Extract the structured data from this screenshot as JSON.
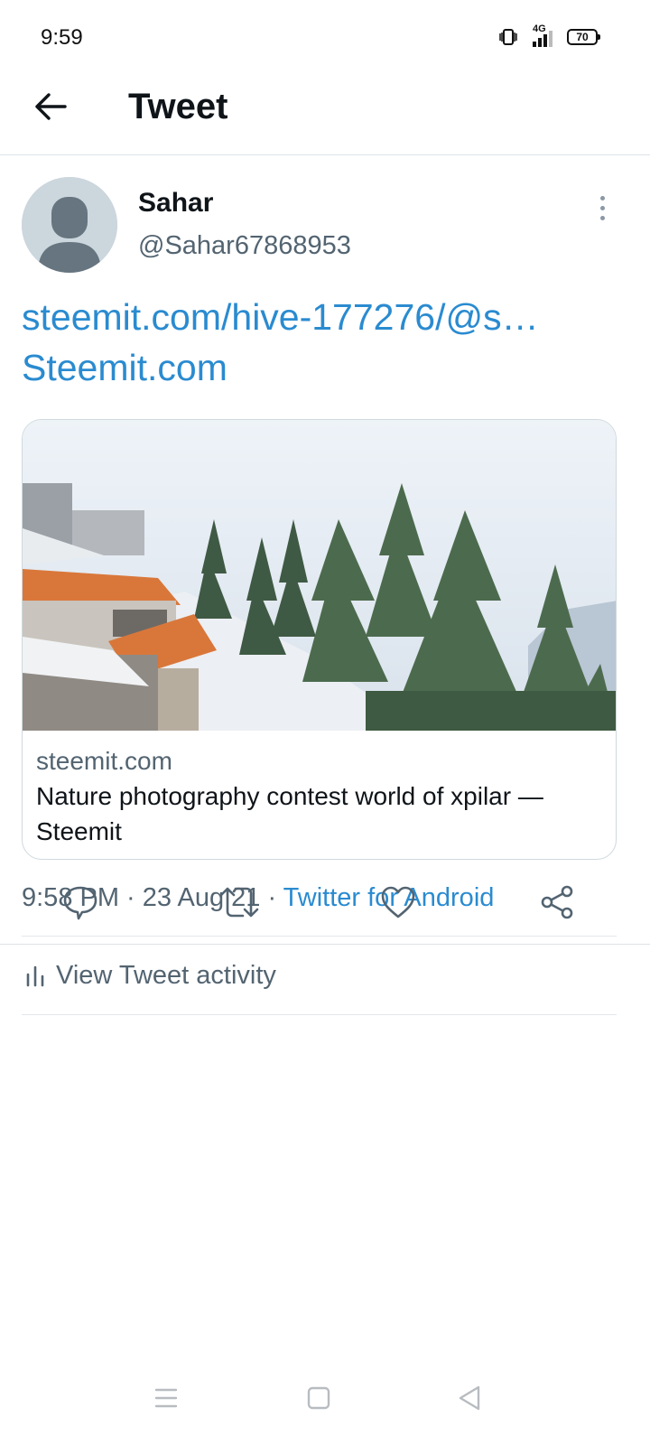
{
  "status_bar": {
    "time": "9:59",
    "network_label": "4G",
    "battery_level": "70",
    "icons": [
      "vibrate-icon",
      "signal-4g-icon",
      "battery-icon"
    ]
  },
  "header": {
    "back_icon": "arrow-left-icon",
    "title": "Tweet"
  },
  "tweet": {
    "author": {
      "display_name": "Sahar",
      "handle": "@Sahar67868953",
      "avatar_icon": "default-avatar-icon"
    },
    "more_icon": "more-vertical-icon",
    "text_line1": "steemit.com/hive-177276/@s…",
    "text_line2": "Steemit.com",
    "card": {
      "domain": "steemit.com",
      "title": "Nature photography contest world of xpilar — Steemit",
      "image_description": "snowy hillside with orange-roofed buildings and pine trees"
    },
    "meta": {
      "time": "9:58 PM",
      "separator": " · ",
      "date": "23 Aug 21",
      "source": "Twitter for Android"
    },
    "activity_label": "View Tweet activity",
    "actions": [
      {
        "name": "reply",
        "icon": "comment-icon"
      },
      {
        "name": "retweet",
        "icon": "retweet-icon"
      },
      {
        "name": "like",
        "icon": "heart-icon"
      },
      {
        "name": "share",
        "icon": "share-icon"
      }
    ]
  },
  "colors": {
    "link": "#2a8bd0",
    "text_primary": "#0f1419",
    "text_secondary": "#536471",
    "divider": "#dfe3e6"
  },
  "nav_bar": {
    "buttons": [
      "menu-icon",
      "home-square-icon",
      "back-triangle-icon"
    ]
  }
}
